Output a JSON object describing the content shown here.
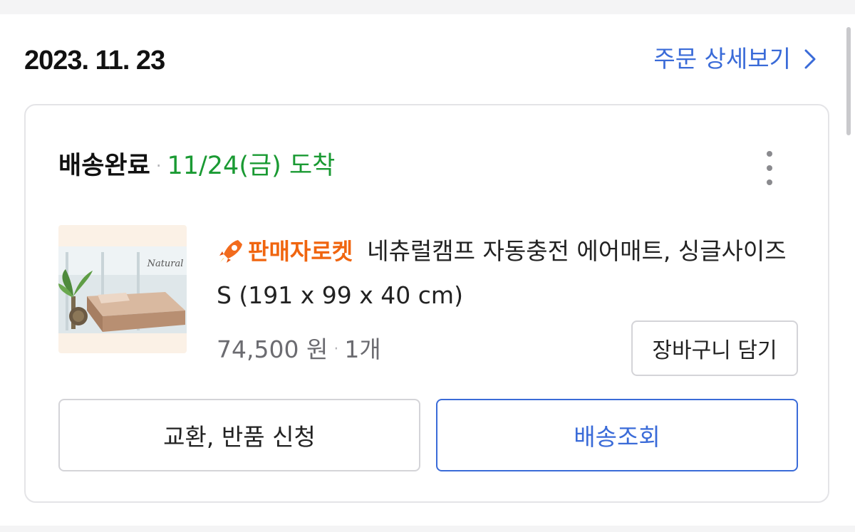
{
  "order": {
    "date": "2023. 11. 23",
    "detail_link_label": "주문 상세보기"
  },
  "shipment": {
    "status": "배송완료",
    "arrival": "11/24(금) 도착"
  },
  "product": {
    "seller_badge": "판매자로켓",
    "name": "네츄럴캠프 자동충전 에어매트, 싱글사이즈 S (191 x 99 x 40 cm)",
    "price": "74,500 원",
    "quantity": "1개",
    "image_alt": "air-mattress-product-photo"
  },
  "buttons": {
    "add_to_cart": "장바구니 담기",
    "exchange_return": "교환, 반품 신청",
    "track_delivery": "배송조회"
  },
  "colors": {
    "accent_blue": "#3a6bd8",
    "delivered_green": "#1a9a33",
    "rocket_orange": "#f0650f"
  },
  "icons": {
    "detail_chevron": "chevron-right-icon",
    "more_menu": "more-vertical-icon",
    "seller_rocket": "rocket-icon"
  }
}
